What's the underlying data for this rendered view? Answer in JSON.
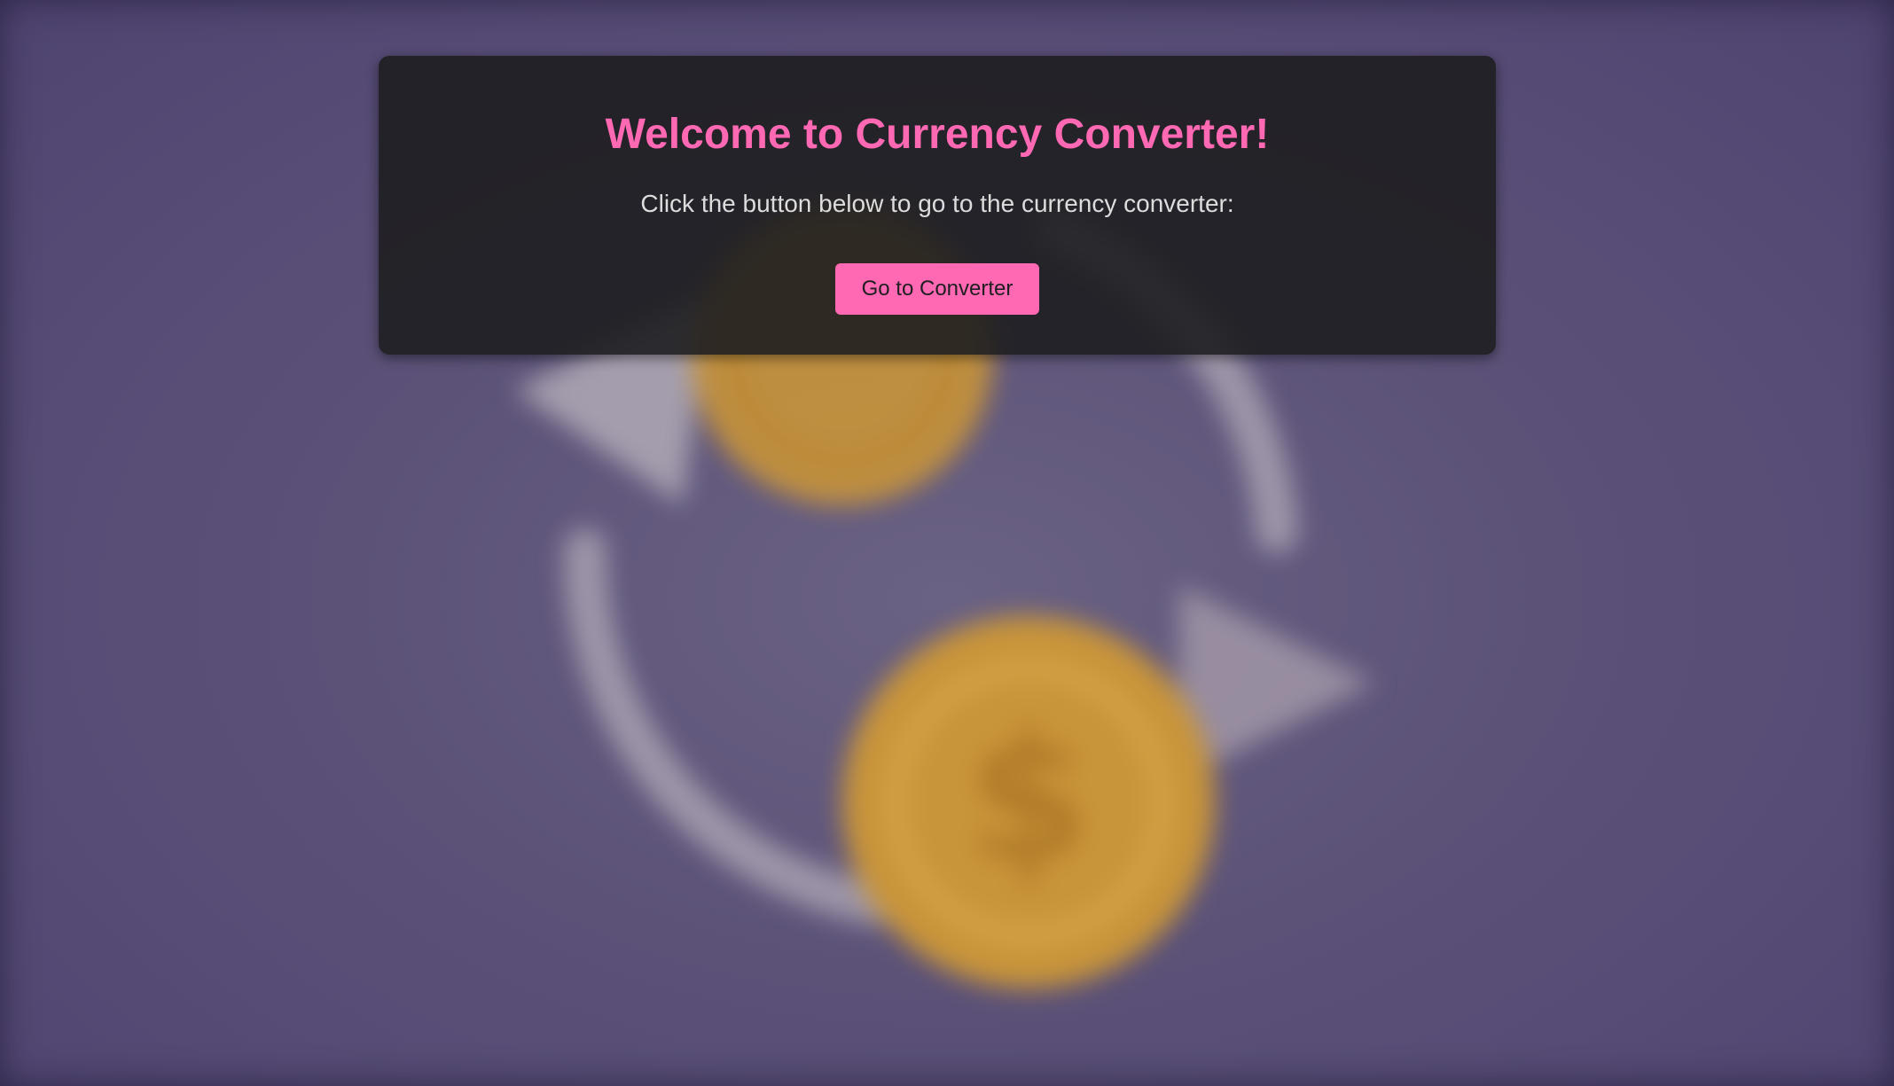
{
  "page": {
    "title": "Welcome to Currency Converter!",
    "subtitle": "Click the button below to go to the currency converter:",
    "button_label": "Go to Converter"
  },
  "background": {
    "icon": "currency-exchange-icon",
    "coin_symbol": "$"
  },
  "colors": {
    "accent": "#ff69b4",
    "card": "#1e1e20",
    "background": "#554a76",
    "coin": "#c9953a",
    "arrow": "#b7b0bd"
  }
}
